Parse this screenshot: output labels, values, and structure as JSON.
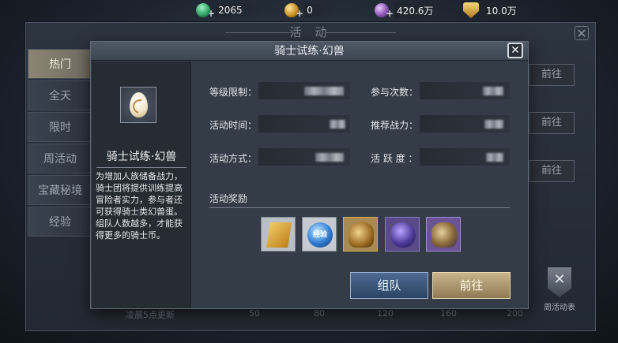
{
  "resources": [
    {
      "icon": "gem-icon",
      "value": "2065"
    },
    {
      "icon": "gold-coin-icon",
      "value": "0"
    },
    {
      "icon": "orb-currency-icon",
      "value": "420.6万"
    },
    {
      "icon": "power-shield-icon",
      "value": "10.0万"
    }
  ],
  "background_window": {
    "title": "活 动",
    "tabs": [
      "热门",
      "全天",
      "限时",
      "周活动",
      "宝藏秘境",
      "经验"
    ],
    "active_tab": "热门",
    "goto_label": "前往",
    "week_activity_label": "周活动表",
    "progress_lead": "凌晨5点更新",
    "progress_marks": [
      "50",
      "80",
      "120",
      "160",
      "200"
    ]
  },
  "modal": {
    "title": "骑士试练·幻兽",
    "panel_title": "骑士试练·幻兽",
    "description": "为增加人族储备战力，骑士团将提供训练提高冒险者实力，参与者还可获得骑士类幻兽蛋。组队人数越多，才能获得更多的骑士币。",
    "fields": {
      "level_limit": "等级限制：",
      "participation_count": "参与次数：",
      "activity_time": "活动时间：",
      "recommended_power": "推荐战力：",
      "activity_mode": "活动方式：",
      "activity_points": "活 跃 度 ："
    },
    "rewards_title": "活动奖励",
    "rewards": [
      {
        "icon": "knight-shield-icon",
        "label": ""
      },
      {
        "icon": "exp-orb-icon",
        "label": "经验"
      },
      {
        "icon": "gold-bag-icon",
        "label": ""
      },
      {
        "icon": "purple-stone-icon",
        "label": ""
      },
      {
        "icon": "purple-bag-icon",
        "label": ""
      }
    ],
    "buttons": {
      "team": "组队",
      "go": "前往"
    }
  }
}
